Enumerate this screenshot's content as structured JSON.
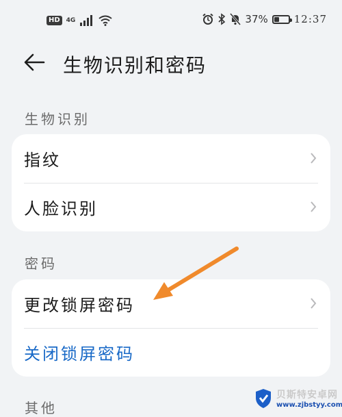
{
  "status_bar": {
    "hd_badge": "HD",
    "network": "4G",
    "battery_percent": "37%",
    "battery_level": 0.37,
    "time": "12:37"
  },
  "header": {
    "title": "生物识别和密码"
  },
  "sections": {
    "biometrics": {
      "label": "生物识别",
      "items": [
        {
          "label": "指纹"
        },
        {
          "label": "人脸识别"
        }
      ]
    },
    "password": {
      "label": "密码",
      "items": [
        {
          "label": "更改锁屏密码"
        },
        {
          "label": "关闭锁屏密码",
          "color": "#1869c7"
        }
      ]
    },
    "other": {
      "label": "其他"
    }
  },
  "annotation": {
    "arrow_color": "#f08a2c"
  },
  "watermark": {
    "name": "贝斯特安卓网",
    "url": "www.zjbstyy.com"
  }
}
